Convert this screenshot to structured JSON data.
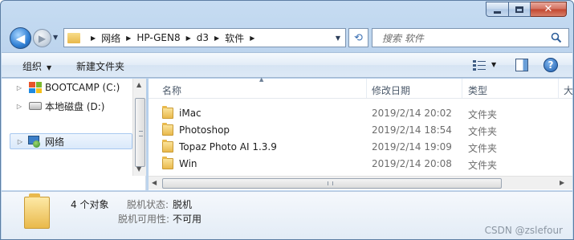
{
  "address": {
    "crumbs": [
      "网络",
      "HP-GEN8",
      "d3",
      "软件"
    ]
  },
  "search": {
    "placeholder": "搜索 软件"
  },
  "toolbar": {
    "organize": "组织",
    "new_folder": "新建文件夹"
  },
  "nav": {
    "items": [
      {
        "label": "BOOTCAMP (C:)"
      },
      {
        "label": "本地磁盘 (D:)"
      },
      {
        "label": "网络"
      }
    ]
  },
  "columns": {
    "name": "名称",
    "date": "修改日期",
    "type": "类型",
    "size": "大"
  },
  "files": [
    {
      "name": "iMac",
      "date": "2019/2/14 20:02",
      "type": "文件夹"
    },
    {
      "name": "Photoshop",
      "date": "2019/2/14 18:54",
      "type": "文件夹"
    },
    {
      "name": "Topaz Photo AI 1.3.9",
      "date": "2019/2/14 19:09",
      "type": "文件夹"
    },
    {
      "name": "Win",
      "date": "2019/2/14 20:08",
      "type": "文件夹"
    }
  ],
  "details": {
    "count": "4 个对象",
    "offline_status_label": "脱机状态:",
    "offline_status_value": "脱机",
    "offline_avail_label": "脱机可用性:",
    "offline_avail_value": "不可用"
  },
  "watermark": "CSDN @zslefour"
}
